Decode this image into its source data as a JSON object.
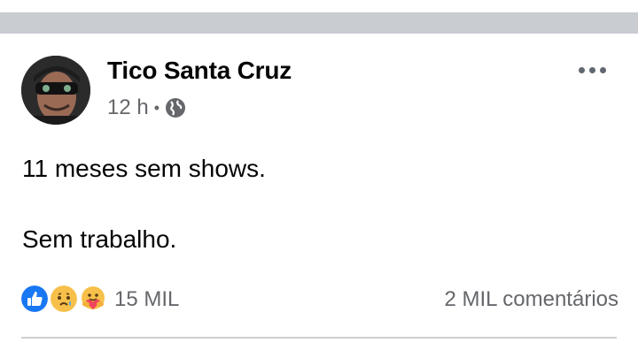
{
  "post": {
    "author": "Tico Santa Cruz",
    "time": "12 h",
    "separator": "•",
    "privacy_icon": "globe-icon",
    "more_icon": "more-options-icon",
    "text": {
      "line1": "11 meses sem shows.",
      "line2": "Sem trabalho."
    },
    "reactions": {
      "icons": [
        "like-reaction-icon",
        "sad-reaction-icon",
        "care-reaction-icon"
      ],
      "count": "15 MIL"
    },
    "comments": "2 MIL comentários"
  },
  "colors": {
    "like_blue": "#1877f2",
    "emoji_yellow": "#f7c04a",
    "care_red": "#f0445b",
    "secondary_text": "#65676b",
    "divider": "#c9ccd1"
  }
}
